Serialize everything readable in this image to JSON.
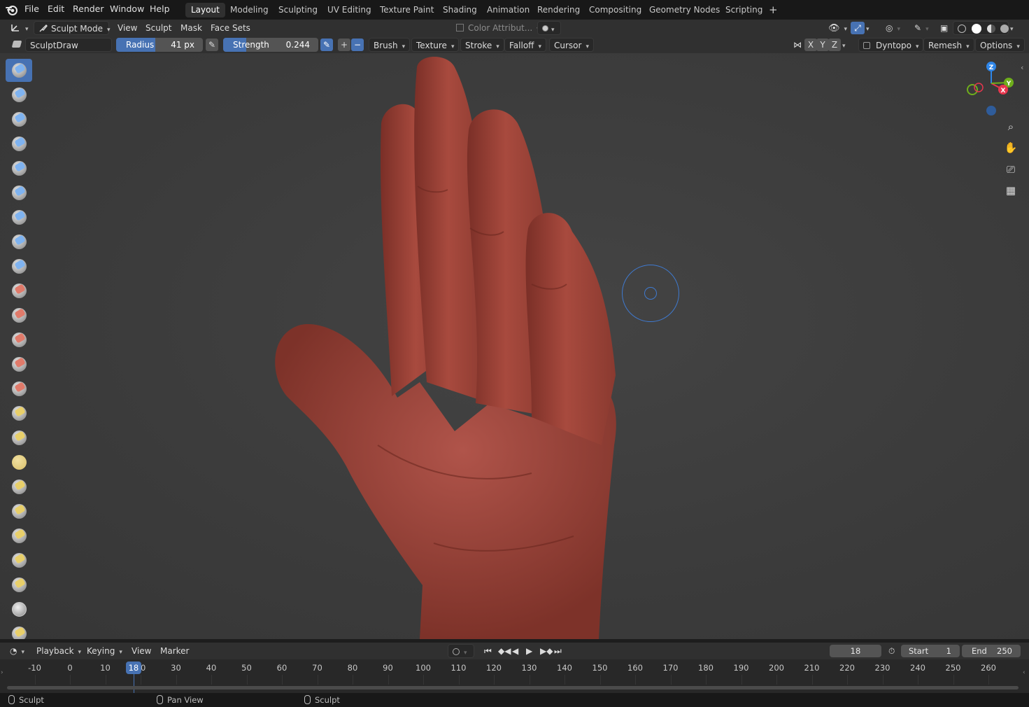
{
  "menu": [
    "File",
    "Edit",
    "Render",
    "Window",
    "Help"
  ],
  "workspaces": [
    "Layout",
    "Modeling",
    "Sculpting",
    "UV Editing",
    "Texture Paint",
    "Shading",
    "Animation",
    "Rendering",
    "Compositing",
    "Geometry Nodes",
    "Scripting"
  ],
  "active_workspace": "Layout",
  "add_workspace": "+",
  "header": {
    "mode": "Sculpt Mode",
    "menus": [
      "View",
      "Sculpt",
      "Mask",
      "Face Sets"
    ],
    "color_attribute": "Color Attribut..."
  },
  "tool_settings": {
    "brush_name": "SculptDraw",
    "radius_label": "Radius",
    "radius_value": "41 px",
    "radius_fill": 0.45,
    "strength_label": "Strength",
    "strength_value": "0.244",
    "strength_fill": 0.244,
    "plus": "+",
    "minus": "−",
    "dropdowns": [
      "Brush",
      "Texture",
      "Stroke",
      "Falloff",
      "Cursor"
    ],
    "symmetry_axes": [
      "X",
      "Y",
      "Z"
    ],
    "dyntopo": "Dyntopo",
    "remesh": "Remesh",
    "options": "Options"
  },
  "gizmo": {
    "x": "X",
    "y": "Y",
    "z": "Z",
    "x_color": "#e8364e",
    "y_color": "#6fae1c",
    "z_color": "#2f86e8"
  },
  "brush_color": "#a1453a",
  "accent": "#4772b3",
  "timeline": {
    "menus": [
      "Playback",
      "Keying",
      "View",
      "Marker"
    ],
    "current_frame": "18",
    "start_label": "Start",
    "start_value": "1",
    "end_label": "End",
    "end_value": "250",
    "ticks": [
      "-10",
      "0",
      "10",
      "20",
      "30",
      "40",
      "50",
      "60",
      "70",
      "80",
      "90",
      "100",
      "110",
      "120",
      "130",
      "140",
      "150",
      "160",
      "170",
      "180",
      "190",
      "200",
      "210",
      "220",
      "230",
      "240",
      "250",
      "260"
    ]
  },
  "status": [
    "Sculpt",
    "Pan View",
    "Sculpt"
  ]
}
